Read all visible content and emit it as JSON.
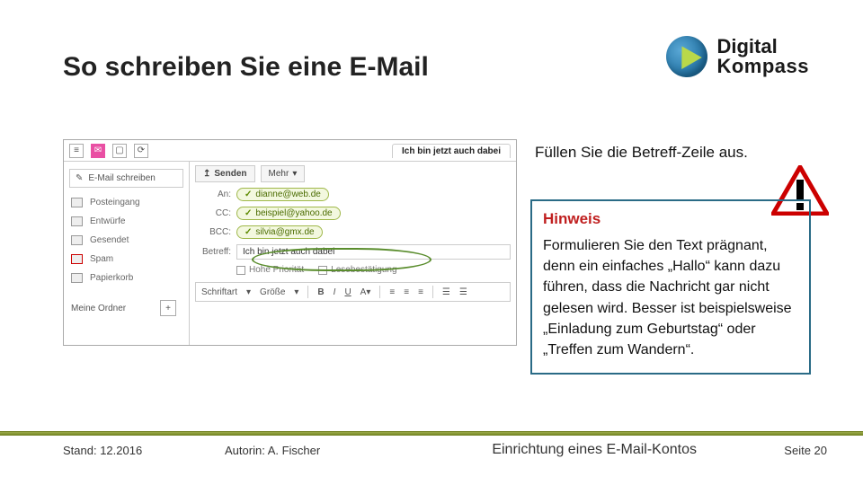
{
  "title": "So schreiben Sie eine E-Mail",
  "logo": {
    "line1": "Digital",
    "line2": "Kompass"
  },
  "instruction": "Füllen Sie die Betreff-Zeile aus.",
  "hint": {
    "title": "Hinweis",
    "body": "Formulieren Sie den Text prägnant, denn ein einfaches „Hallo“ kann dazu führen, dass die Nachricht gar nicht gelesen wird. Besser ist beispielsweise „Einladung zum Geburtstag“ oder „Treffen zum Wandern“."
  },
  "mail": {
    "tab": "Ich bin jetzt auch dabei",
    "compose": "E-Mail schreiben",
    "folders": [
      "Posteingang",
      "Entwürfe",
      "Gesendet",
      "Spam",
      "Papierkorb"
    ],
    "myfolders": "Meine Ordner",
    "send": "Senden",
    "more": "Mehr",
    "fields": {
      "an_label": "An:",
      "an_value": "dianne@web.de",
      "cc_label": "CC:",
      "cc_value": "beispiel@yahoo.de",
      "bcc_label": "BCC:",
      "bcc_value": "silvia@gmx.de",
      "subject_label": "Betreff:",
      "subject_value": "Ich bin jetzt auch dabei"
    },
    "options": {
      "priority": "Hohe Priorität",
      "receipt": "Lesebestätigung"
    },
    "toolbar": {
      "font": "Schriftart",
      "size": "Größe"
    }
  },
  "footer": {
    "date": "Stand: 12.2016",
    "author": "Autorin: A. Fischer",
    "topic": "Einrichtung eines E-Mail-Kontos",
    "page": "Seite 20"
  }
}
